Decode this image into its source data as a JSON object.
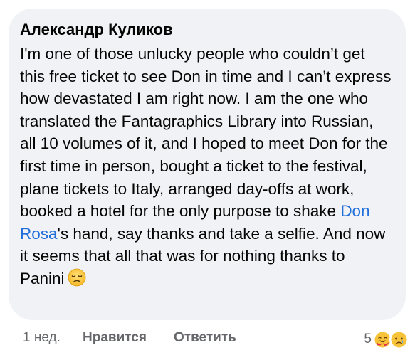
{
  "comment": {
    "author": "Александр Куликов",
    "text_before_mention": "I'm one of those unlucky people who couldn’t get this free ticket to see Don in time and I can’t express how devastated I am right now. I am the one who translated the Fantagraphics Library into Russian, all 10 volumes of it, and I hoped to meet Don for the first time in person, bought a ticket to the festival, plane tickets to Italy, arranged day-offs at work, booked a hotel for the only purpose to shake ",
    "mention": "Don Rosa",
    "text_after_mention": "'s hand, say thanks and take a selfie. And now it seems that all that was for nothing thanks to Panini",
    "emoji_icon": "disappointed-face-emoji",
    "mention_color": "#216fdb"
  },
  "footer": {
    "time": "1 нед.",
    "like_label": "Нравится",
    "reply_label": "Ответить",
    "reaction_count": "5",
    "reaction_icons": [
      "hugging-face-reaction-icon",
      "sad-face-reaction-icon"
    ]
  }
}
